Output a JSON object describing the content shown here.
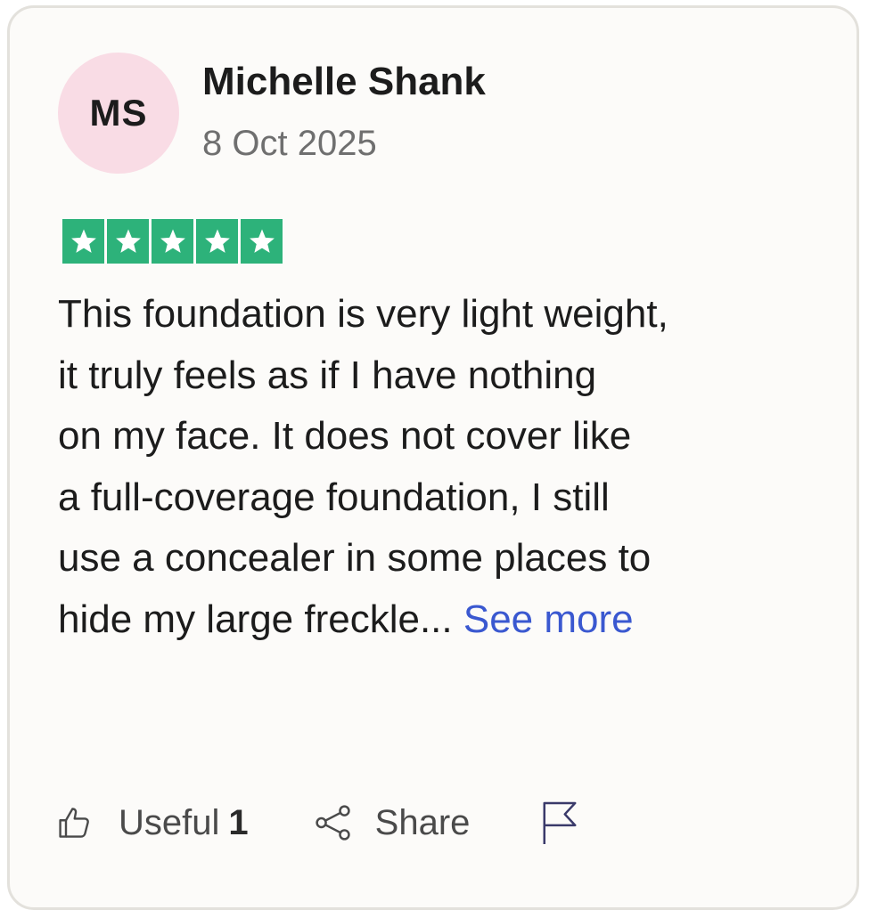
{
  "review": {
    "avatar_initials": "MS",
    "author": "Michelle Shank",
    "date": "8 Oct 2025",
    "rating": 5,
    "rating_max": 5,
    "text_lines": [
      "This foundation is very light weight,",
      "it truly feels as if I have nothing",
      "on my face. It does not cover like",
      "a full-coverage foundation, I still",
      "use a concealer in some places to",
      "hide my large freckle..."
    ],
    "see_more_label": "See more"
  },
  "actions": {
    "useful_label": "Useful",
    "useful_count": "1",
    "share_label": "Share"
  },
  "icons": {
    "useful": "thumbs-up-icon",
    "share": "share-icon",
    "report": "flag-icon",
    "rating": "star-icon"
  },
  "colors": {
    "star_green": "#2db27a",
    "avatar_bg": "#f9dce5",
    "link_blue": "#3a58d0",
    "card_border": "#e3e1dc",
    "card_bg": "#fcfbf9"
  }
}
